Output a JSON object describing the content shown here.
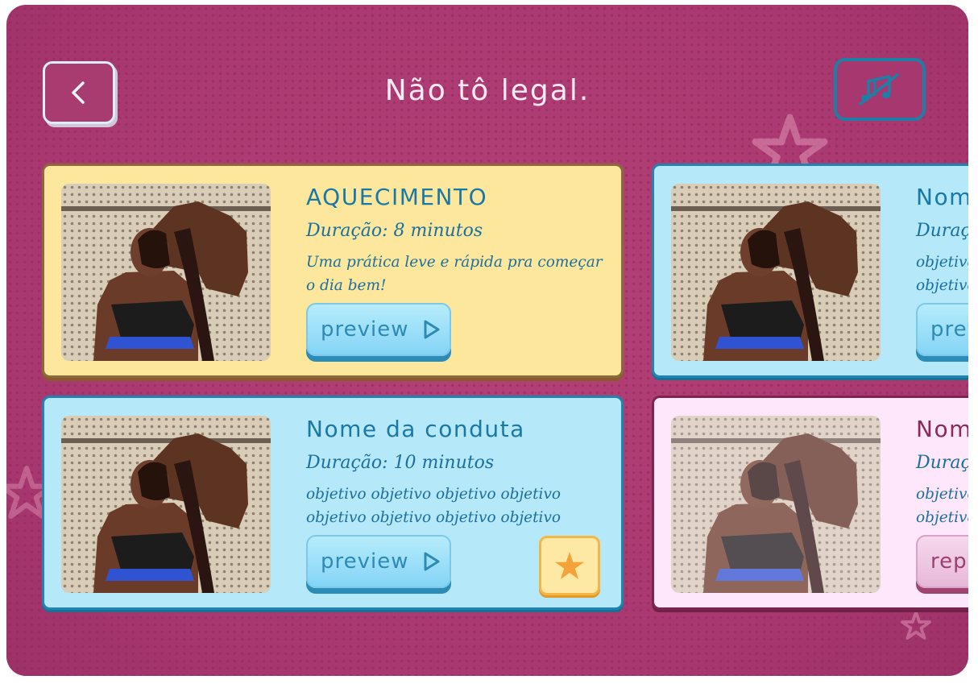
{
  "header": {
    "title": "Não tô legal.",
    "back_icon": "chevron-left-icon",
    "music_icon": "music-off-icon"
  },
  "cards": [
    {
      "title": "AQUECIMENTO",
      "duration": "Duração: 8 minutos",
      "description": "Uma prática leve e rápida pra começar o dia bem!",
      "button_label": "preview",
      "theme": "yellow"
    },
    {
      "title": "Nom",
      "duration": "Duraçã",
      "description": "objetivo objetivo",
      "button_label": "prev",
      "theme": "blue"
    },
    {
      "title": "Nome da conduta",
      "duration": "Duração: 10 minutos",
      "description": "objetivo objetivo objetivo objetivo objetivo objetivo objetivo objetivo",
      "button_label": "preview",
      "theme": "blue",
      "favorite_icon": "star-icon"
    },
    {
      "title": "Nom",
      "duration": "Duraçã",
      "description": "objetivo objetivo",
      "button_label": "rep",
      "theme": "pink"
    }
  ],
  "colors": {
    "background": "#ad3b72",
    "yellow_card": "#fde79c",
    "blue_card": "#b5e8f8",
    "pink_card": "#ffe7fb",
    "accent_blue": "#1a78a6"
  }
}
